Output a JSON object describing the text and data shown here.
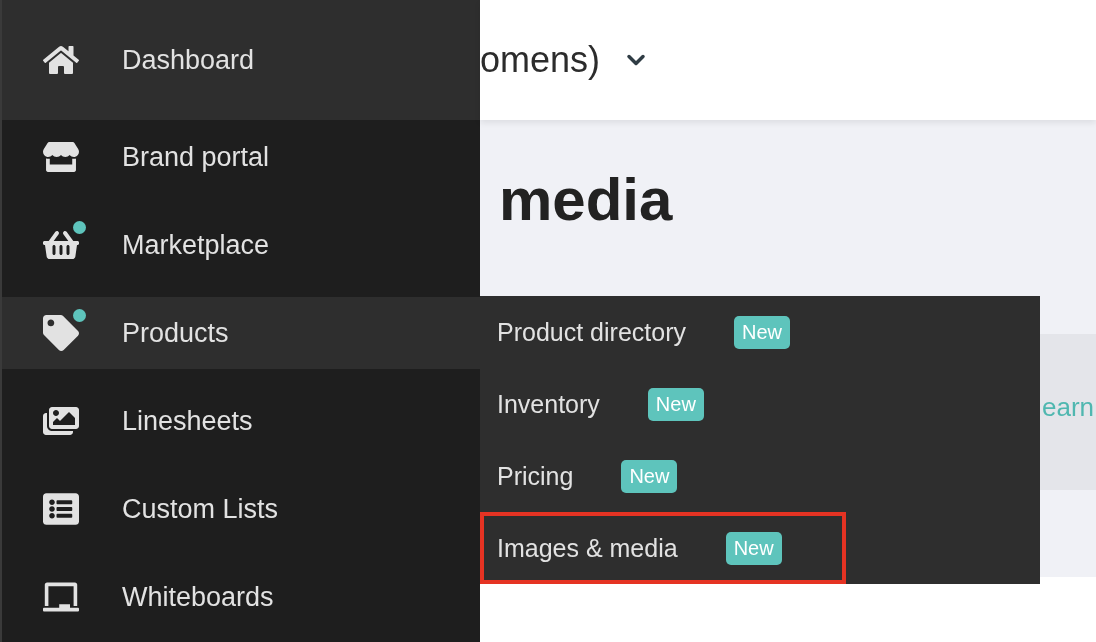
{
  "sidebar": {
    "items": [
      {
        "label": "Dashboard",
        "highlighted": true,
        "dot": false
      },
      {
        "label": "Brand portal",
        "highlighted": false,
        "dot": false
      },
      {
        "label": "Marketplace",
        "highlighted": false,
        "dot": true,
        "color": "#5ec4bc"
      },
      {
        "label": "Products",
        "highlighted": true,
        "dot": true,
        "color": "#5ec4bc"
      },
      {
        "label": "Linesheets",
        "highlighted": false,
        "dot": false
      },
      {
        "label": "Custom Lists",
        "highlighted": false,
        "dot": false
      },
      {
        "label": "Whiteboards",
        "highlighted": false,
        "dot": false
      }
    ]
  },
  "header": {
    "title": "omens)"
  },
  "page": {
    "title": "media",
    "notice_link": "earn"
  },
  "submenu": {
    "items": [
      {
        "label": "Product directory",
        "badge": "New",
        "outlined": false
      },
      {
        "label": "Inventory",
        "badge": "New",
        "outlined": false
      },
      {
        "label": "Pricing",
        "badge": "New",
        "outlined": false
      },
      {
        "label": "Images & media",
        "badge": "New",
        "outlined": true
      }
    ]
  }
}
